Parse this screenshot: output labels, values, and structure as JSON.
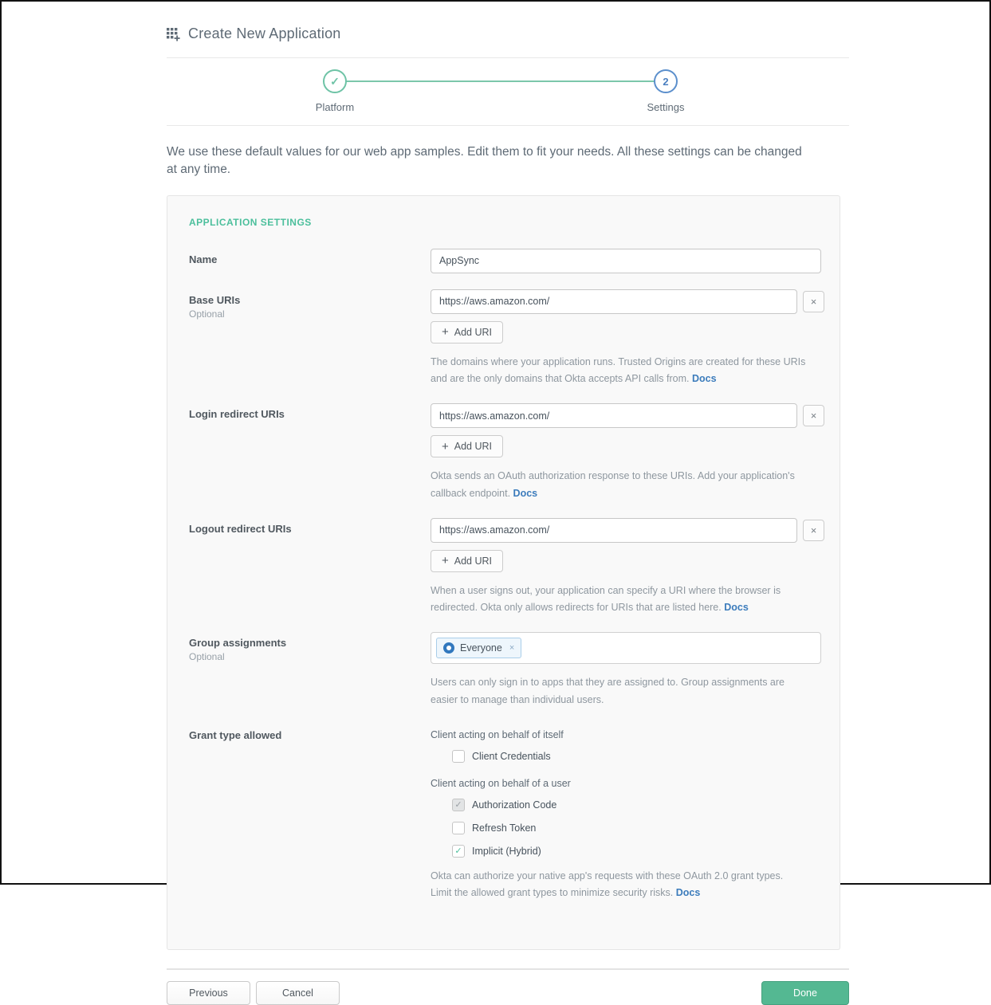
{
  "header": {
    "title": "Create New Application"
  },
  "stepper": {
    "steps": [
      {
        "label": "Platform",
        "state": "complete"
      },
      {
        "label": "Settings",
        "state": "current",
        "number": "2"
      }
    ]
  },
  "intro": "We use these default values for our web app samples. Edit them to fit your needs. All these settings can be changed at any time.",
  "panel": {
    "section_title": "APPLICATION SETTINGS",
    "add_uri_label": "Add URI",
    "docs_label": "Docs",
    "remove_label": "×",
    "fields": {
      "name": {
        "label": "Name",
        "value": "AppSync"
      },
      "base_uris": {
        "label": "Base URIs",
        "sublabel": "Optional",
        "value": "https://aws.amazon.com/",
        "help": "The domains where your application runs. Trusted Origins are created for these URIs and are the only domains that Okta accepts API calls from. "
      },
      "login_redirect_uris": {
        "label": "Login redirect URIs",
        "value": "https://aws.amazon.com/",
        "help": "Okta sends an OAuth authorization response to these URIs. Add your application's callback endpoint. "
      },
      "logout_redirect_uris": {
        "label": "Logout redirect URIs",
        "value": "https://aws.amazon.com/",
        "help": "When a user signs out, your application can specify a URI where the browser is redirected. Okta only allows redirects for URIs that are listed here. "
      },
      "group_assignments": {
        "label": "Group assignments",
        "sublabel": "Optional",
        "chip_label": "Everyone",
        "chip_remove": "×",
        "help": "Users can only sign in to apps that they are assigned to. Group assignments are easier to manage than individual users."
      },
      "grant_type": {
        "label": "Grant type allowed",
        "group1_title": "Client acting on behalf of itself",
        "group2_title": "Client acting on behalf of a user",
        "checkboxes": [
          {
            "label": "Client Credentials",
            "checked": false,
            "disabled": false
          },
          {
            "label": "Authorization Code",
            "checked": true,
            "disabled": true
          },
          {
            "label": "Refresh Token",
            "checked": false,
            "disabled": false
          },
          {
            "label": "Implicit (Hybrid)",
            "checked": true,
            "disabled": false
          }
        ],
        "help": "Okta can authorize your native app's requests with these OAuth 2.0 grant types. Limit the allowed grant types to minimize security risks. "
      }
    }
  },
  "footer": {
    "previous_label": "Previous",
    "cancel_label": "Cancel",
    "done_label": "Done"
  },
  "colors": {
    "accent_green": "#4cbf9c",
    "stepper_green": "#6ec3a6",
    "step_blue": "#5b8fcc",
    "link_blue": "#3c7cbc",
    "done_green": "#54b892",
    "panel_bg": "#f9f9f9"
  }
}
